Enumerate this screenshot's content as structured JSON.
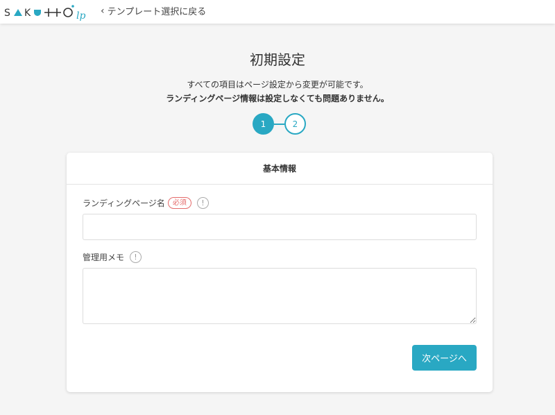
{
  "header": {
    "logo_text": "SAKUTTO lp",
    "back_label": "テンプレート選択に戻る"
  },
  "page": {
    "title": "初期設定",
    "description_line1": "すべての項目はページ設定から変更が可能です。",
    "description_line2": "ランディングページ情報は設定しなくても問題ありません。"
  },
  "stepper": {
    "steps": [
      "1",
      "2"
    ],
    "current_step": 1
  },
  "card": {
    "title": "基本情報",
    "fields": {
      "landing_page_name": {
        "label": "ランディングページ名",
        "required_badge": "必須",
        "info": "!",
        "value": ""
      },
      "memo": {
        "label": "管理用メモ",
        "info": "!",
        "value": ""
      }
    },
    "next_button": "次ページへ"
  },
  "colors": {
    "accent": "#29a8c3",
    "required": "#e46a6a",
    "background": "#f5f5f5"
  }
}
